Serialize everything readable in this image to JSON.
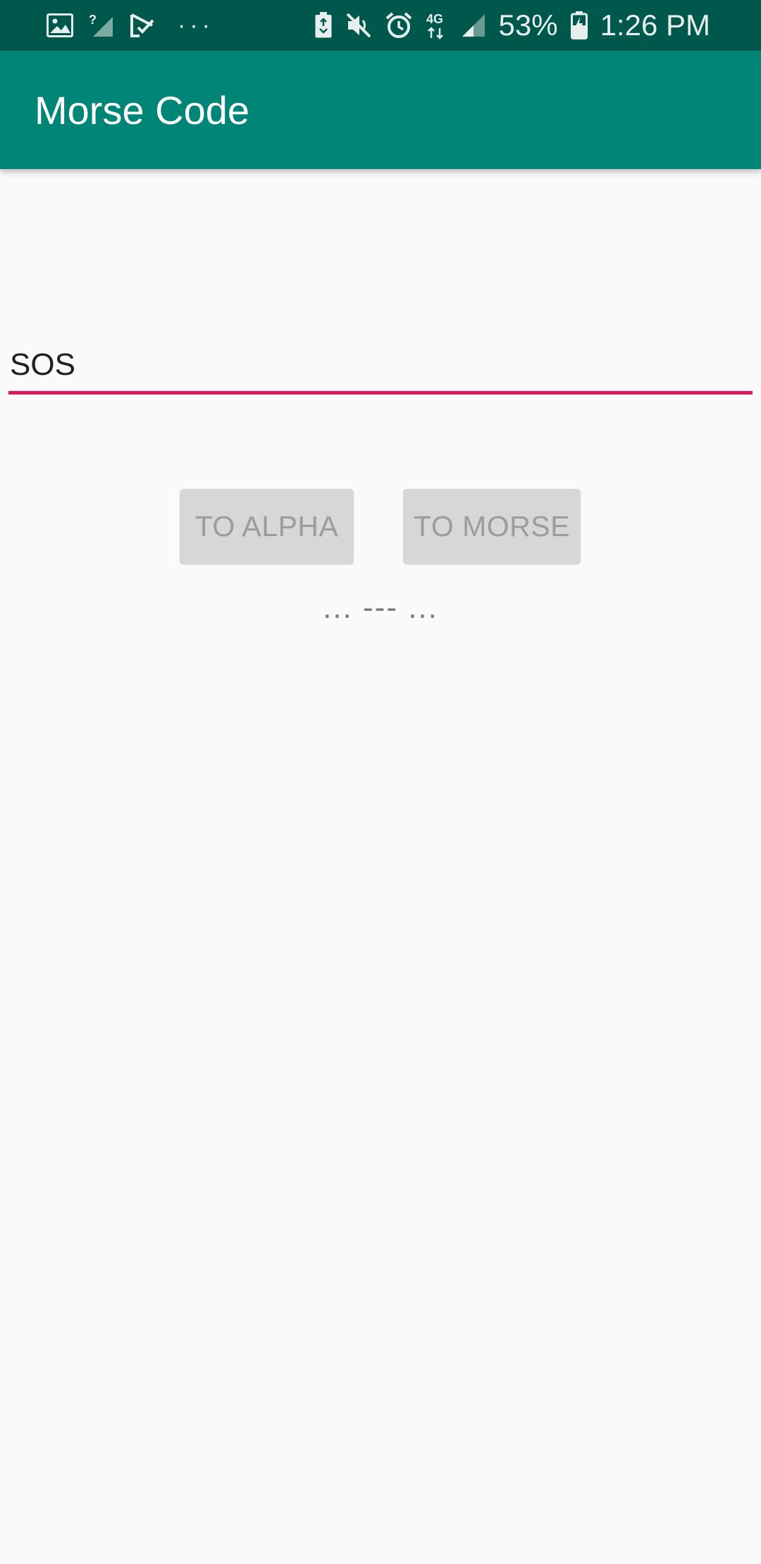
{
  "status_bar": {
    "left_icons": [
      "image-icon",
      "no-signal-icon",
      "download-done-icon"
    ],
    "more_indicator": "···",
    "right_icons": [
      "battery-saver-icon",
      "mute-icon",
      "alarm-icon",
      "network-4g-icon",
      "signal-icon"
    ],
    "network_label": "4G",
    "battery_percent": "53%",
    "time": "1:26 PM",
    "background_color": "#00574b"
  },
  "app_bar": {
    "title": "Morse Code",
    "background_color": "#008577"
  },
  "input": {
    "value": "SOS",
    "underline_color": "#d81b60"
  },
  "buttons": {
    "to_alpha": "TO ALPHA",
    "to_morse": "TO MORSE"
  },
  "output": {
    "text": "... --- ..."
  }
}
